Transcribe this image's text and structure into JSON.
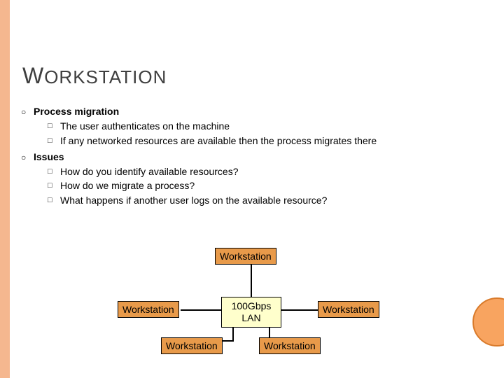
{
  "title_cap": "W",
  "title_rest": "ORKSTATION",
  "bullets": [
    {
      "heading": "Process migration",
      "subs": [
        "The user authenticates on the machine",
        "If any networked resources are available then the process migrates there"
      ]
    },
    {
      "heading": "Issues",
      "subs": [
        "How do you identify available resources?",
        "How do we migrate a process?",
        "What happens if another user logs on the available resource?"
      ]
    }
  ],
  "diagram": {
    "lan_label": "100Gbps LAN",
    "nodes": {
      "top": "Workstation",
      "left": "Workstation",
      "right": "Workstation",
      "bottom_left": "Workstation",
      "bottom_right": "Workstation"
    }
  }
}
